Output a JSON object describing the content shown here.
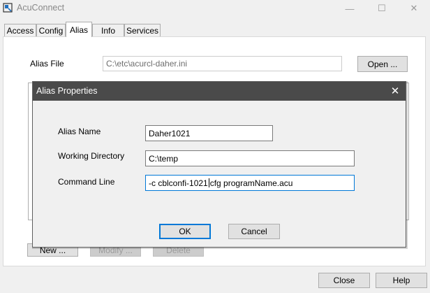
{
  "window": {
    "title": "AcuConnect",
    "minimize_glyph": "—",
    "maximize_glyph": "☐",
    "close_glyph": "✕"
  },
  "tabs": [
    {
      "label": "Access"
    },
    {
      "label": "Config"
    },
    {
      "label": "Alias"
    },
    {
      "label": "Info"
    },
    {
      "label": "Services"
    }
  ],
  "alias_tab": {
    "alias_file_label": "Alias File",
    "alias_file_value": "C:\\etc\\acurcl-daher.ini",
    "open_button": "Open ...",
    "new_button": "New ...",
    "modify_button": "Modify ...",
    "delete_button": "Delete"
  },
  "dialog": {
    "title": "Alias Properties",
    "close_glyph": "✕",
    "alias_name_label": "Alias Name",
    "alias_name_value": "Daher1021",
    "working_directory_label": "Working Directory",
    "working_directory_value": "C:\\temp",
    "command_line_label": "Command Line",
    "command_line_before_cursor": "-c cblconfi-1021",
    "command_line_after_cursor": "cfg programName.acu",
    "ok_button": "OK",
    "cancel_button": "Cancel"
  },
  "footer": {
    "close_button": "Close",
    "help_button": "Help"
  },
  "colors": {
    "dialog_titlebar": "#4a4a4a",
    "focus_border": "#0078d7",
    "window_bg": "#f0f0f0"
  },
  "icons": {
    "app": "acuconnect-app-icon"
  }
}
